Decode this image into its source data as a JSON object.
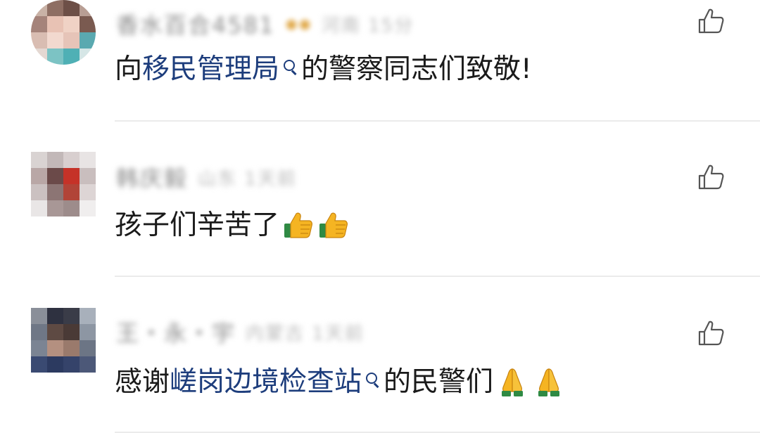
{
  "comments": [
    {
      "username": "香水百合4581",
      "time_info": "河南 15分",
      "parts": [
        {
          "text": "向",
          "link": false
        },
        {
          "text": "移民管理局",
          "link": true
        },
        {
          "text": "的警察同志们致敬!",
          "link": false
        }
      ]
    },
    {
      "username": "韩庆毅",
      "time_info": "山东 1天前",
      "parts": [
        {
          "text": "孩子们辛苦了",
          "link": false
        }
      ],
      "emoji": [
        "thumbs-up",
        "thumbs-up"
      ]
    },
    {
      "username": "王・永・宇",
      "time_info": "内蒙古 1天前",
      "parts": [
        {
          "text": "感谢",
          "link": false
        },
        {
          "text": "嵯岗边境检查站",
          "link": true
        },
        {
          "text": "的民警们",
          "link": false
        }
      ],
      "emoji": [
        "folded-hands",
        "folded-hands"
      ]
    }
  ],
  "colors": {
    "link": "#1d3d7c",
    "text": "#1a1a1a",
    "divider": "#ebebeb",
    "icon": "#555555"
  },
  "icons": {
    "like": "thumbs-up-outline-icon",
    "search": "search-icon"
  }
}
